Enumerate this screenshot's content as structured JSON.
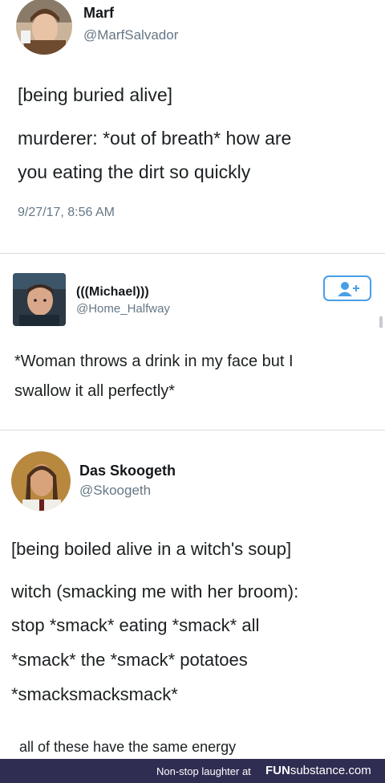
{
  "tweet1": {
    "name": "Marf",
    "handle": "@MarfSalvador",
    "line1": "[being buried alive]",
    "line2": "murderer: *out of breath* how are",
    "line3": "you eating the dirt so quickly",
    "timestamp": "9/27/17, 8:56 AM"
  },
  "tweet2": {
    "name": "(((Michael)))",
    "handle": "@Home_Halfway",
    "follow_icon": "add-user-icon",
    "line1": "*Woman throws a drink in my face but I",
    "line2": "swallow it all perfectly*"
  },
  "tweet3": {
    "name": "Das Skoogeth",
    "handle": "@Skoogeth",
    "line1": "[being boiled alive in a witch's soup]",
    "line2": "witch (smacking me with her broom):",
    "line3": "stop *smack* eating *smack* all",
    "line4": "*smack* the *smack* potatoes",
    "line5": "*smacksmacksmack*"
  },
  "caption": "all of these have the same energy",
  "footer": {
    "tagline": "Non-stop laughter at",
    "brand_prefix": "FUN",
    "brand_suffix": "substance.com",
    "background_color": "#2f2d52"
  }
}
